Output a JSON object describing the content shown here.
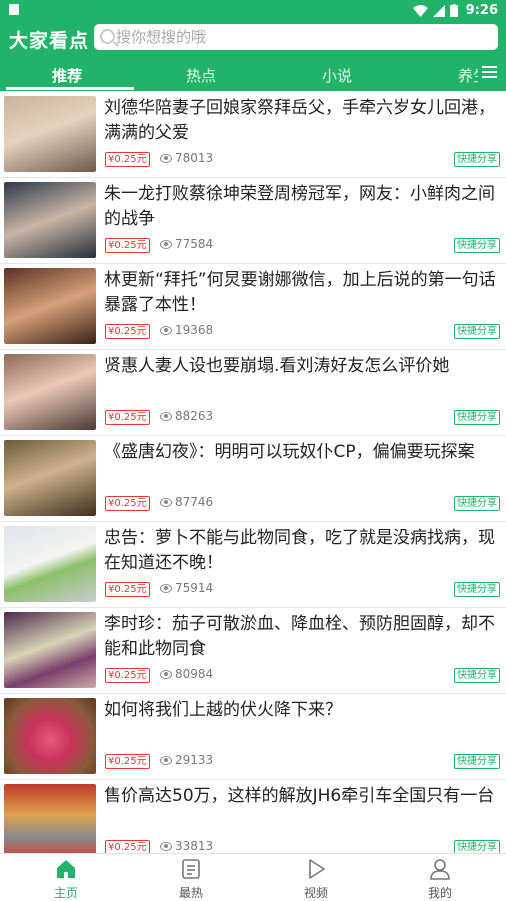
{
  "status": {
    "time": "9:26"
  },
  "app": {
    "title": "大家看点"
  },
  "search": {
    "placeholder": "搜你想搜的哦"
  },
  "tabs": [
    {
      "label": "推荐"
    },
    {
      "label": "热点"
    },
    {
      "label": "小说"
    },
    {
      "label": "养生"
    }
  ],
  "feed": [
    {
      "title": "刘德华陪妻子回娘家祭拜岳父，手牵六岁女儿回港，满满的父爱",
      "price": "¥0.25元",
      "views": "78013",
      "share": "快捷分享"
    },
    {
      "title": "朱一龙打败蔡徐坤荣登周榜冠军，网友：小鲜肉之间的战争",
      "price": "¥0.25元",
      "views": "77584",
      "share": "快捷分享"
    },
    {
      "title": "林更新“拜托”何炅要谢娜微信，加上后说的第一句话暴露了本性！",
      "price": "¥0.25元",
      "views": "19368",
      "share": "快捷分享"
    },
    {
      "title": "贤惠人妻人设也要崩塌.看刘涛好友怎么评价她",
      "price": "¥0.25元",
      "views": "88263",
      "share": "快捷分享"
    },
    {
      "title": "《盛唐幻夜》：明明可以玩奴仆CP，偏偏要玩探案",
      "price": "¥0.25元",
      "views": "87746",
      "share": "快捷分享"
    },
    {
      "title": "忠告：萝卜不能与此物同食，吃了就是没病找病，现在知道还不晚！",
      "price": "¥0.25元",
      "views": "75914",
      "share": "快捷分享"
    },
    {
      "title": "李时珍：茄子可散淤血、降血栓、预防胆固醇，却不能和此物同食",
      "price": "¥0.25元",
      "views": "80984",
      "share": "快捷分享"
    },
    {
      "title": "如何将我们上越的伏火降下来？",
      "price": "¥0.25元",
      "views": "29133",
      "share": "快捷分享"
    },
    {
      "title": "售价高达50万，这样的解放JH6牵引车全国只有一台",
      "price": "¥0.25元",
      "views": "33813",
      "share": "快捷分享"
    }
  ],
  "bottom_nav": [
    {
      "label": "主页",
      "icon": "home-icon"
    },
    {
      "label": "最热",
      "icon": "list-icon"
    },
    {
      "label": "视频",
      "icon": "play-icon"
    },
    {
      "label": "我的",
      "icon": "person-icon"
    }
  ],
  "colors": {
    "brand": "#22b36a",
    "price": "#e53935"
  }
}
